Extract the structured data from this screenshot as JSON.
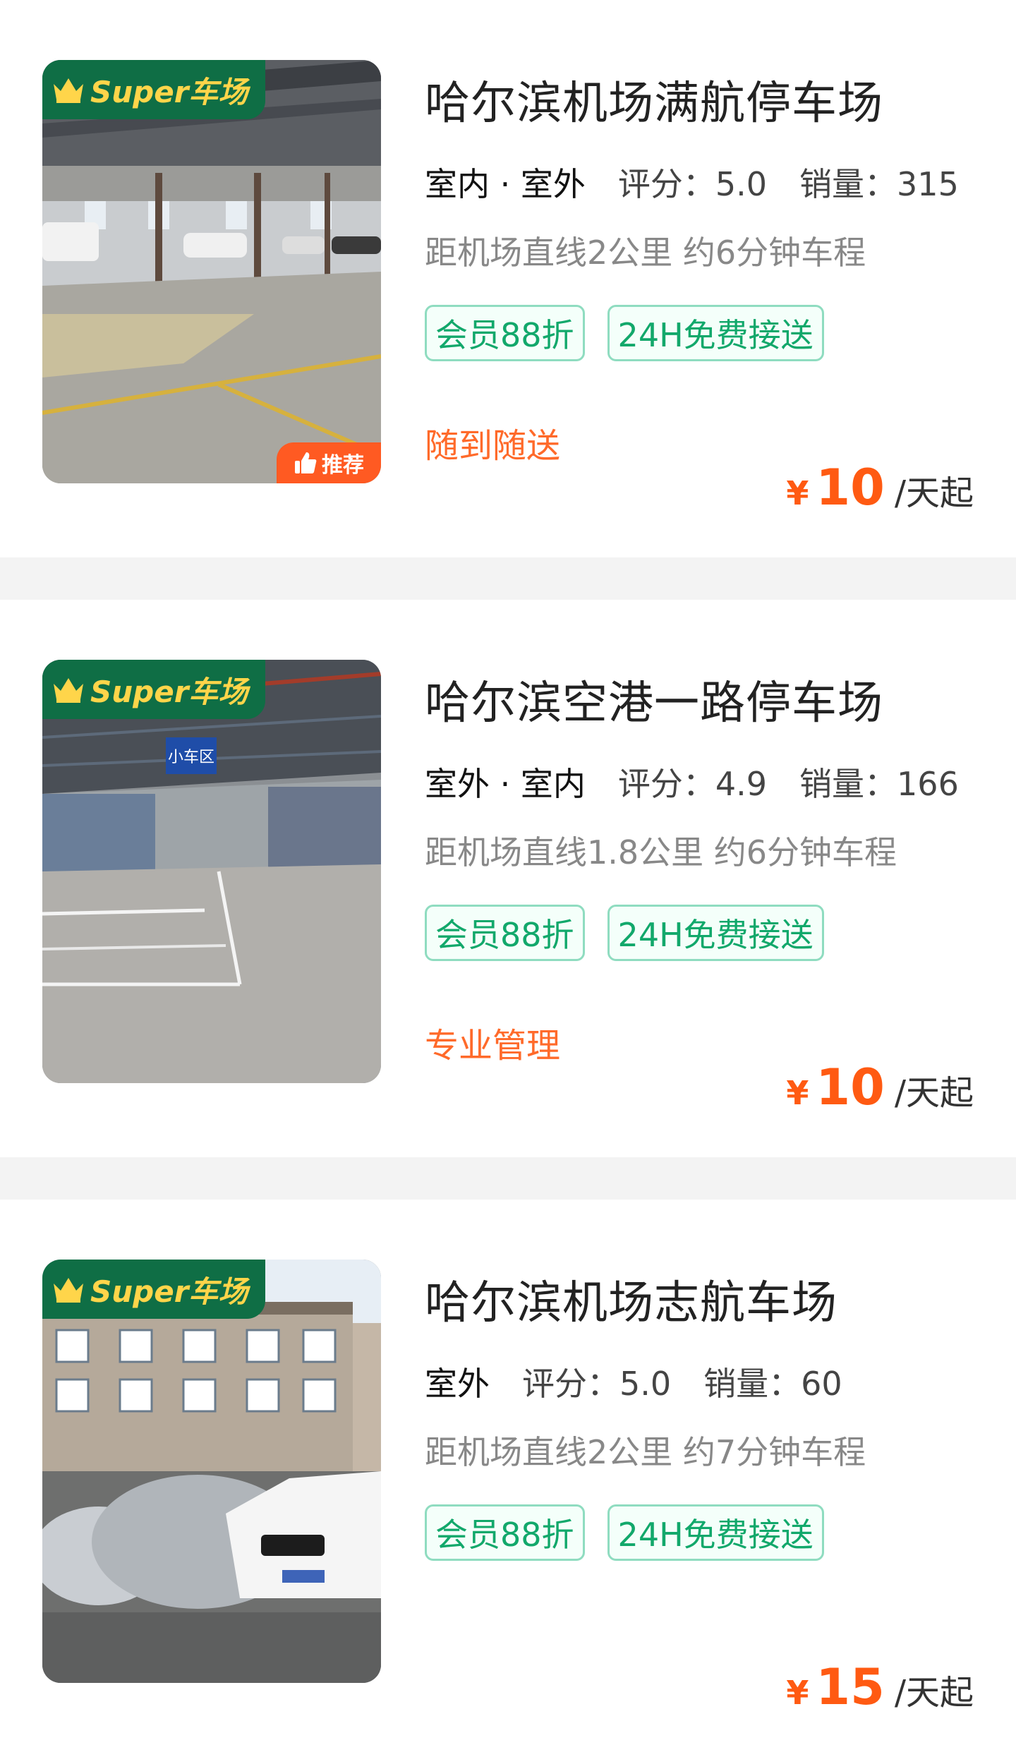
{
  "listings": [
    {
      "title": "哈尔滨机场满航停车场",
      "badge": "Super车场",
      "recommend": "推荐",
      "location": "室内 · 室外",
      "rating_label": "评分：5.0",
      "sales_label": "销量：315",
      "distance": "距机场直线2公里 约6分钟车程",
      "tags": [
        "会员88折",
        "24H免费接送"
      ],
      "feature": "随到随送",
      "price_symbol": "¥",
      "price": "10",
      "price_unit": "/天起",
      "image": "indoor-garage-photo"
    },
    {
      "title": "哈尔滨空港一路停车场",
      "badge": "Super车场",
      "location": "室外 · 室内",
      "rating_label": "评分：4.9",
      "sales_label": "销量：166",
      "distance": "距机场直线1.8公里 约6分钟车程",
      "tags": [
        "会员88折",
        "24H免费接送"
      ],
      "feature": "专业管理",
      "price_symbol": "¥",
      "price": "10",
      "price_unit": "/天起",
      "sign_text": "小车区",
      "image": "covered-shed-photo"
    },
    {
      "title": "哈尔滨机场志航车场",
      "badge": "Super车场",
      "location": "室外",
      "rating_label": "评分：5.0",
      "sales_label": "销量：60",
      "distance": "距机场直线2公里 约7分钟车程",
      "tags": [
        "会员88折",
        "24H免费接送"
      ],
      "feature": "",
      "price_symbol": "¥",
      "price": "15",
      "price_unit": "/天起",
      "image": "outdoor-lot-photo"
    }
  ],
  "colors": {
    "badge_bg": "#0f6e45",
    "badge_text": "#ffd54a",
    "tag_text": "#12a86b",
    "tag_border": "#8fdcc0",
    "price": "#ff5a12",
    "feature": "#ff6a2a",
    "separator": "#f3f3f3"
  }
}
